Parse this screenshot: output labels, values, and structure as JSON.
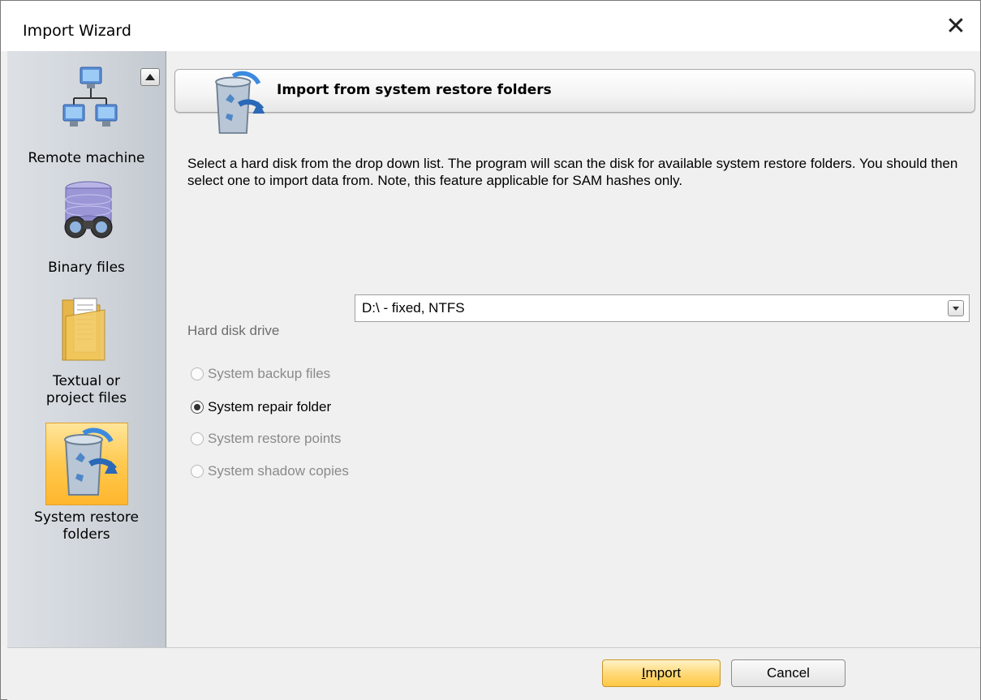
{
  "window": {
    "title": "Import Wizard",
    "close_glyph": "✕"
  },
  "sidebar": {
    "items": [
      {
        "label": "Remote machine",
        "icon": "network-computers-icon",
        "active": false
      },
      {
        "label": "Binary files",
        "icon": "database-binoculars-icon",
        "active": false
      },
      {
        "label_lines": [
          "Textual or",
          "project files"
        ],
        "icon": "folder-document-icon",
        "active": false
      },
      {
        "label_lines": [
          "System restore",
          "folders"
        ],
        "icon": "recycle-bin-icon",
        "active": true
      }
    ]
  },
  "header": {
    "title": "Import from system restore folders",
    "icon": "recycle-bin-icon"
  },
  "description": "Select a hard disk from the drop down list. The program will scan the disk for available system restore folders. You should then select one to import data from. Note, this feature applicable for SAM hashes only.",
  "drive": {
    "label": "Hard disk drive",
    "value": "D:\\ - fixed, NTFS"
  },
  "options": [
    {
      "label": "System backup files",
      "checked": false,
      "enabled": false
    },
    {
      "label": "System repair folder",
      "checked": true,
      "enabled": true
    },
    {
      "label": "System restore points",
      "checked": false,
      "enabled": false
    },
    {
      "label": "System shadow copies",
      "checked": false,
      "enabled": false
    }
  ],
  "buttons": {
    "import_label": "Import",
    "cancel_label": "Cancel"
  },
  "colors": {
    "accent": "#ffc94f",
    "sidebar_bg": "#cfd4da"
  }
}
